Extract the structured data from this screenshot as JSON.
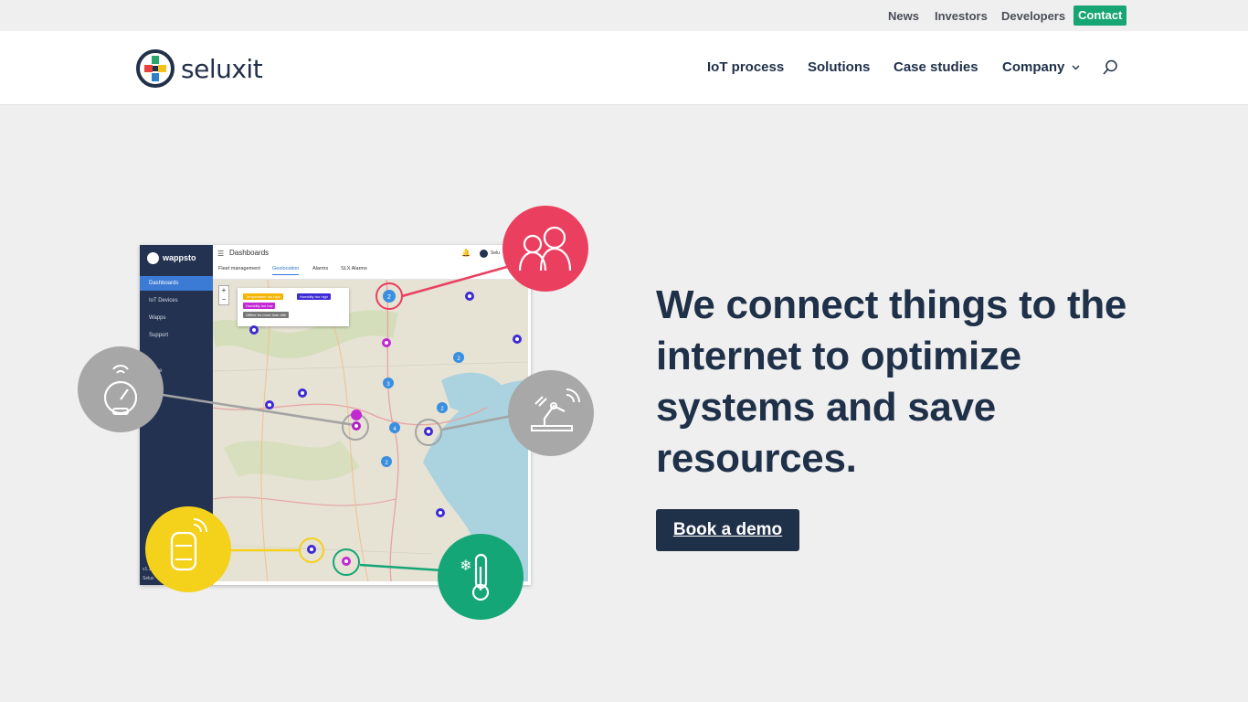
{
  "topbar": {
    "links": [
      "News",
      "Investors",
      "Developers"
    ],
    "contact_label": "Contact"
  },
  "header": {
    "logo_text": "seluxit",
    "nav": [
      "IoT process",
      "Solutions",
      "Case studies",
      "Company"
    ]
  },
  "hero": {
    "title": "We connect things to the internet to optimize systems and save resources.",
    "cta_label": "Book a demo"
  },
  "dashboard": {
    "brand": "wappsto",
    "title": "Dashboards",
    "sidebar": [
      "Dashboards",
      "IoT Devices",
      "Wapps",
      "Support",
      "Store"
    ],
    "tabs": [
      "Fleet management",
      "Geolocation",
      "Alarms",
      "SLX Alarms"
    ],
    "chips": [
      "Temperature too high",
      "Humidity too high",
      "Humidity too low",
      "Offline for more than 48h"
    ],
    "version": "v1.1",
    "footer_text": "Selux",
    "user": "Selu",
    "cluster_counts": [
      "2",
      "2",
      "3",
      "2",
      "4",
      "2"
    ]
  },
  "colors": {
    "brand_navy": "#1f3049",
    "contact_green": "#17a673",
    "people_red": "#ea3f5f",
    "gauge_gray": "#a7a7a7",
    "car_yellow": "#f4d11b",
    "thermo_green": "#14a676",
    "robot_gray": "#a8a8a8"
  },
  "icons": [
    "people-icon",
    "gauge-icon",
    "robot-arm-icon",
    "car-icon",
    "thermometer-icon",
    "search-icon",
    "chevron-down-icon"
  ]
}
